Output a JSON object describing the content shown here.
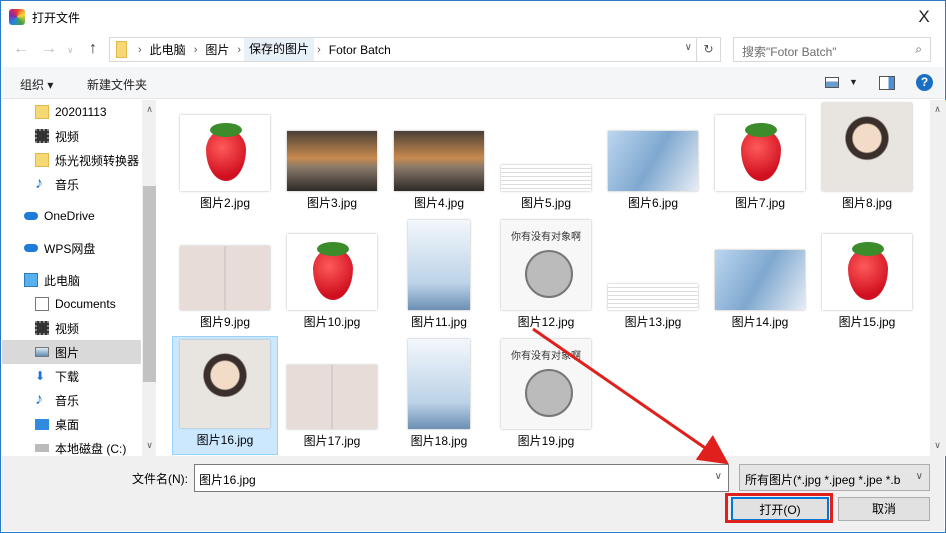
{
  "window": {
    "title": "打开文件",
    "close": "X"
  },
  "address": {
    "crumbs": [
      "此电脑",
      "图片",
      "保存的图片",
      "Fotor Batch"
    ],
    "search_placeholder": "搜索\"Fotor Batch\""
  },
  "toolbar": {
    "organize": "组织 ▾",
    "new_folder": "新建文件夹",
    "help": "?"
  },
  "sidebar": {
    "items": [
      {
        "label": "20201113",
        "icon": "folder-icon"
      },
      {
        "label": "视频",
        "icon": "video-icon"
      },
      {
        "label": "烁光视频转换器",
        "icon": "folder-icon"
      },
      {
        "label": "音乐",
        "icon": "music-icon"
      },
      {
        "label": "OneDrive",
        "icon": "cloud-icon"
      },
      {
        "label": "WPS网盘",
        "icon": "cloud-icon"
      },
      {
        "label": "此电脑",
        "icon": "computer-icon"
      },
      {
        "label": "Documents",
        "icon": "document-icon"
      },
      {
        "label": "视频",
        "icon": "video-icon"
      },
      {
        "label": "图片",
        "icon": "picture-icon",
        "selected": true
      },
      {
        "label": "下载",
        "icon": "download-icon"
      },
      {
        "label": "音乐",
        "icon": "music-icon"
      },
      {
        "label": "桌面",
        "icon": "desktop-icon"
      },
      {
        "label": "本地磁盘 (C:)",
        "icon": "drive-icon"
      }
    ]
  },
  "files": [
    {
      "name": "图片2.jpg",
      "kind": "straw"
    },
    {
      "name": "图片3.jpg",
      "kind": "road"
    },
    {
      "name": "图片4.jpg",
      "kind": "road"
    },
    {
      "name": "图片5.jpg",
      "kind": "doc"
    },
    {
      "name": "图片6.jpg",
      "kind": "boy"
    },
    {
      "name": "图片7.jpg",
      "kind": "straw"
    },
    {
      "name": "图片8.jpg",
      "kind": "girl"
    },
    {
      "name": "图片9.jpg",
      "kind": "cert"
    },
    {
      "name": "图片10.jpg",
      "kind": "straw"
    },
    {
      "name": "图片11.jpg",
      "kind": "bottle"
    },
    {
      "name": "图片12.jpg",
      "kind": "ham"
    },
    {
      "name": "图片13.jpg",
      "kind": "doc"
    },
    {
      "name": "图片14.jpg",
      "kind": "boy"
    },
    {
      "name": "图片15.jpg",
      "kind": "straw"
    },
    {
      "name": "图片16.jpg",
      "kind": "girl",
      "selected": true
    },
    {
      "name": "图片17.jpg",
      "kind": "cert"
    },
    {
      "name": "图片18.jpg",
      "kind": "bottle"
    },
    {
      "name": "图片19.jpg",
      "kind": "ham"
    }
  ],
  "thumb_text": "你有没有对象啊",
  "bottom": {
    "filename_label": "文件名(N):",
    "filename_value": "图片16.jpg",
    "filter": "所有图片(*.jpg *.jpeg *.jpe *.b",
    "open": "打开(O)",
    "cancel": "取消"
  },
  "colors": {
    "accent": "#0078d7",
    "annotation": "#e0201c",
    "selection": "#cce8ff"
  }
}
